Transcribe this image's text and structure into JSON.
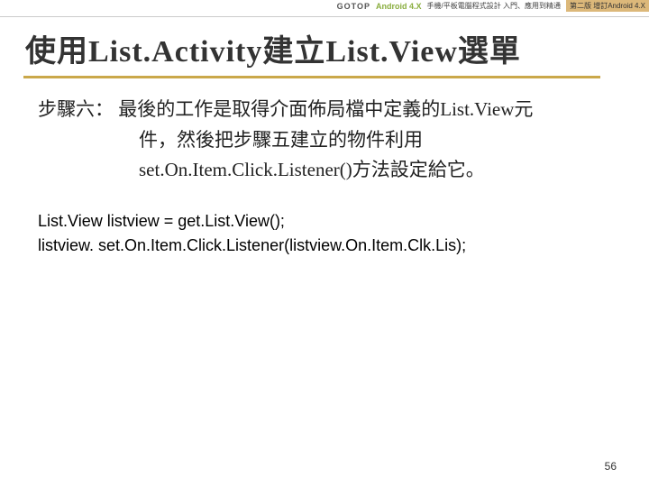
{
  "header": {
    "logo1": "GOTOP",
    "logo2": "Android 4.X",
    "logo2_sub": "手機/平板電腦程式設計\n入門、應用到精通",
    "badge": "第二版 增訂Android 4.X"
  },
  "title": "使用List.Activity建立List.View選單",
  "step": {
    "label": "步驟六：",
    "line1": "最後的工作是取得介面佈局檔中定義的List.View元",
    "line2": "件，然後把步驟五建立的物件利用",
    "line3": "set.On.Item.Click.Listener()方法設定給它。"
  },
  "code": {
    "line1": "List.View listview = get.List.View();",
    "line2": "listview. set.On.Item.Click.Listener(listview.On.Item.Clk.Lis);"
  },
  "pagenum": "56"
}
